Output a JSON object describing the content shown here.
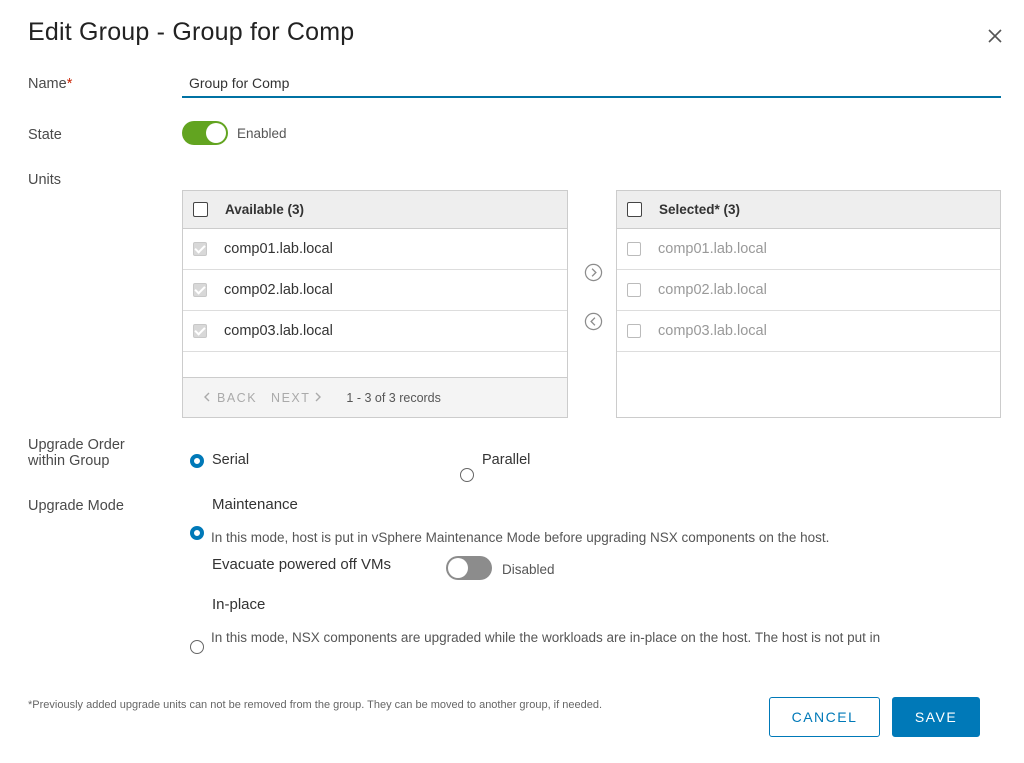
{
  "dialog": {
    "title": "Edit Group - Group for Comp"
  },
  "form": {
    "name_label": "Name",
    "required_mark": "*",
    "name_value": "Group for Comp",
    "state_label": "State",
    "state_value": "Enabled",
    "units_label": "Units",
    "upgrade_order_label_line1": "Upgrade Order",
    "upgrade_order_label_line2": "within Group",
    "upgrade_mode_label": "Upgrade Mode"
  },
  "available": {
    "header": "Available (3)",
    "items": [
      "comp01.lab.local",
      "comp02.lab.local",
      "comp03.lab.local"
    ],
    "footer": {
      "back_label": "BACK",
      "next_label": "NEXT",
      "records": "1 - 3 of 3 records"
    }
  },
  "selected": {
    "header": "Selected* (3)",
    "items": [
      "comp01.lab.local",
      "comp02.lab.local",
      "comp03.lab.local"
    ]
  },
  "upgrade_order": {
    "options": [
      "Serial",
      "Parallel"
    ],
    "selected": "Serial"
  },
  "upgrade_mode": {
    "maintenance_label": "Maintenance",
    "maintenance_help": "In this mode, host is put in vSphere Maintenance Mode before upgrading NSX components on the host.",
    "evacuate_label": "Evacuate powered off VMs",
    "evacuate_state": "Disabled",
    "inplace_label": "In-place",
    "inplace_help": "In this mode, NSX components are upgraded while the workloads are in-place on the host. The host is not put in",
    "selected": "Maintenance"
  },
  "footer": {
    "note": "*Previously added upgrade units can not be removed from the group. They can be moved to another group, if needed.",
    "cancel_label": "CANCEL",
    "save_label": "SAVE"
  },
  "colors": {
    "accent": "#0079b8",
    "toggle_on": "#62a420",
    "toggle_off": "#8c8c8c",
    "required": "#c92100"
  },
  "icons": {
    "close": "close-icon",
    "move_right": "chevron-right-circle-icon",
    "move_left": "chevron-left-circle-icon"
  }
}
